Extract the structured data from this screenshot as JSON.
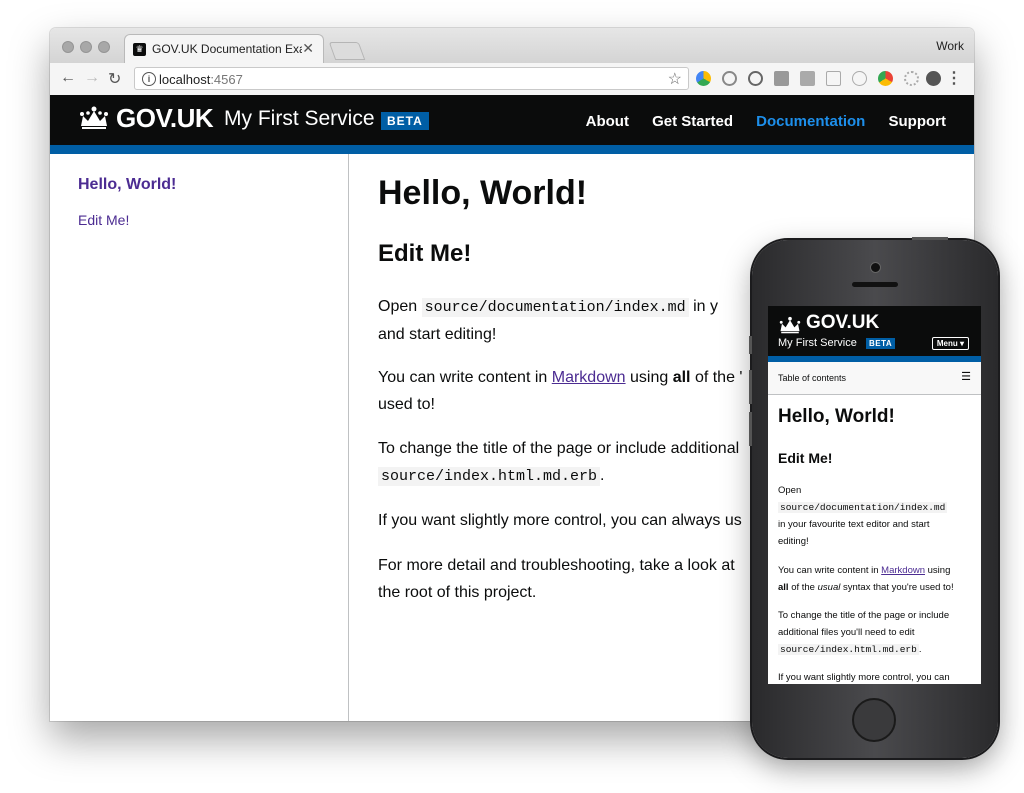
{
  "browser": {
    "tab_title": "GOV.UK Documentation Example",
    "profile": "Work",
    "url_host": "localhost",
    "url_port": ":4567"
  },
  "header": {
    "logo": "GOV.UK",
    "service": "My First Service",
    "badge": "BETA",
    "nav": [
      "About",
      "Get Started",
      "Documentation",
      "Support"
    ],
    "active_nav": "Documentation",
    "active_color": "#1d8feb",
    "accent": "#005ea5"
  },
  "sidebar": {
    "heading": "Hello, World!",
    "link": "Edit Me!"
  },
  "content": {
    "title": "Hello, World!",
    "subtitle": "Edit Me!",
    "p1a": "Open ",
    "p1_code": "source/documentation/index.md",
    "p1b": " in y",
    "p1c": "and start editing!",
    "p2a": "You can write content in ",
    "p2_link": "Markdown",
    "p2b": " using ",
    "p2_bold": "all",
    "p2c": " of the '",
    "p2d": "used to!",
    "p3a": "To change the title of the page or include additional",
    "p3_code": "source/index.html.md.erb",
    "p3b": ".",
    "p4": "If you want slightly more control, you can always us",
    "p5a": "For more detail and troubleshooting, take a look at",
    "p5b": "the root of this project."
  },
  "mobile": {
    "logo": "GOV.UK",
    "service": "My First Service",
    "badge": "BETA",
    "menu": "Menu ▾",
    "toc": "Table of contents",
    "title": "Hello, World!",
    "subtitle": "Edit Me!",
    "p1a": "Open",
    "p1_code": "source/documentation/index.md",
    "p1b": "in your favourite text editor and start",
    "p1c": "editing!",
    "p2a": "You can write content in ",
    "p2_link": "Markdown",
    "p2b": " using",
    "p2_bold": "all",
    "p2c": " of the ",
    "p2_italic": "usual",
    "p2d": " syntax that you're used to!",
    "p3a": "To change the title of the page or include",
    "p3b": "additional files you'll need to edit",
    "p3_code": "source/index.html.md.erb",
    "p3c": ".",
    "p4": "If you want slightly more control, you can"
  }
}
